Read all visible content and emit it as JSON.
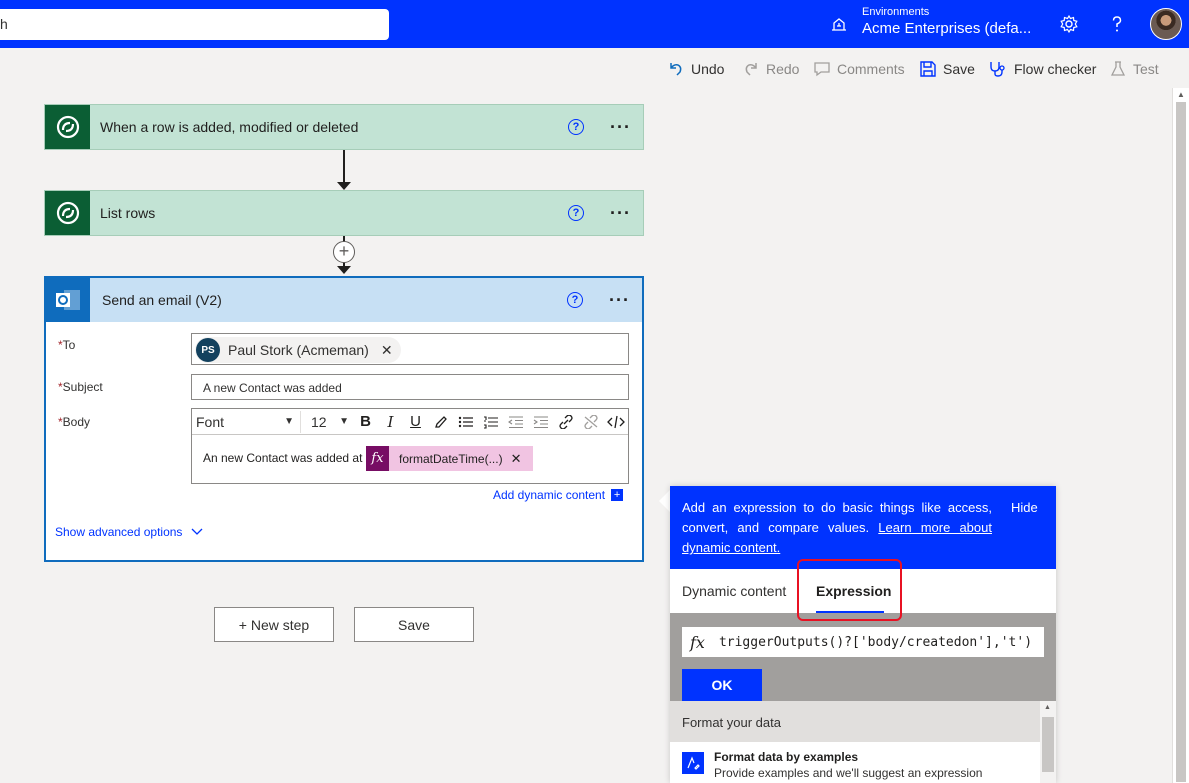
{
  "topbar": {
    "search_text": "h",
    "env_label": "Environments",
    "env_name": "Acme Enterprises (defa..."
  },
  "commands": {
    "undo": "Undo",
    "redo": "Redo",
    "comments": "Comments",
    "save": "Save",
    "flow_checker": "Flow checker",
    "test": "Test"
  },
  "steps": {
    "trigger_title": "When a row is added, modified or deleted",
    "list_rows_title": "List rows",
    "email": {
      "title": "Send an email (V2)",
      "to_label": "To",
      "to_initials": "PS",
      "to_name": "Paul Stork (Acmeman)",
      "subject_label": "Subject",
      "subject_value": "A new Contact was added",
      "body_label": "Body",
      "font": "Font",
      "font_size": "12",
      "body_text": "An new Contact was added at",
      "token_label": "formatDateTime(...)",
      "add_dynamic": "Add dynamic content",
      "advanced": "Show advanced options"
    }
  },
  "footer": {
    "new_step": "+ New step",
    "save": "Save"
  },
  "panel": {
    "info": "Add an expression to do basic things like access, convert, and compare values.",
    "learn_more": "Learn more about dynamic content.",
    "hide": "Hide",
    "tab_dynamic": "Dynamic content",
    "tab_expression": "Expression",
    "expression": "triggerOutputs()?['body/createdon'],'t')",
    "ok": "OK",
    "format_header": "Format your data",
    "format_title": "Format data by examples",
    "format_desc": "Provide examples and we'll suggest an expression"
  },
  "colors": {
    "brand": "#0033ff",
    "dataverse": "#0b5e34",
    "outlook": "#0f6cbd",
    "highlight": "#e81123"
  },
  "icons": [
    "environment-icon",
    "settings-icon",
    "help-icon",
    "undo-icon",
    "redo-icon",
    "comments-icon",
    "save-icon",
    "flow-checker-icon",
    "test-icon",
    "dataverse-icon",
    "outlook-icon",
    "fx-icon"
  ]
}
